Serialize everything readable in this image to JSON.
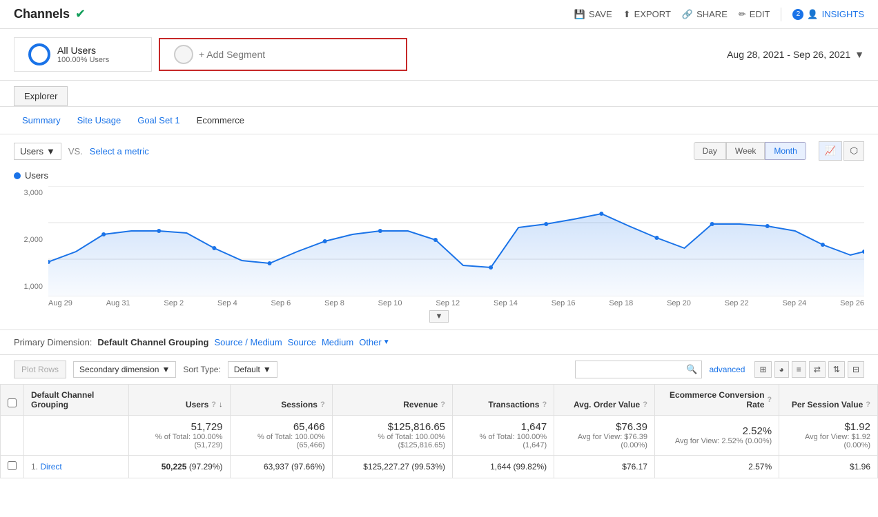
{
  "header": {
    "title": "Channels",
    "save_label": "SAVE",
    "export_label": "EXPORT",
    "share_label": "SHARE",
    "edit_label": "EDIT",
    "insights_label": "INSIGHTS",
    "insights_badge": "2"
  },
  "segment": {
    "name": "All Users",
    "pct": "100.00% Users",
    "add_label": "+ Add Segment"
  },
  "date_range": {
    "value": "Aug 28, 2021 - Sep 26, 2021"
  },
  "explorer_tab": "Explorer",
  "sub_tabs": [
    {
      "label": "Summary",
      "active": true
    },
    {
      "label": "Site Usage",
      "active": false
    },
    {
      "label": "Goal Set 1",
      "active": false
    },
    {
      "label": "Ecommerce",
      "active": false,
      "plain": true
    }
  ],
  "chart_controls": {
    "metric": "Users",
    "vs_label": "VS.",
    "select_metric": "Select a metric",
    "time_buttons": [
      "Day",
      "Week",
      "Month"
    ],
    "active_time": "Month"
  },
  "chart": {
    "legend_label": "Users",
    "y_labels": [
      "3,000",
      "2,000",
      "1,000"
    ],
    "x_labels": [
      "Aug 29",
      "Aug 31",
      "Sep 2",
      "Sep 4",
      "Sep 6",
      "Sep 8",
      "Sep 10",
      "Sep 12",
      "Sep 14",
      "Sep 16",
      "Sep 18",
      "Sep 20",
      "Sep 22",
      "Sep 24",
      "Sep 26"
    ]
  },
  "dimension_bar": {
    "label": "Primary Dimension:",
    "active": "Default Channel Grouping",
    "links": [
      "Source / Medium",
      "Source",
      "Medium",
      "Other"
    ]
  },
  "table_controls": {
    "plot_rows": "Plot Rows",
    "secondary_dim": "Secondary dimension",
    "sort_type_label": "Sort Type:",
    "sort_type": "Default",
    "advanced_label": "advanced"
  },
  "table": {
    "columns": [
      {
        "label": "Default Channel Grouping",
        "align": "left"
      },
      {
        "label": "Users",
        "info": true,
        "sort": true
      },
      {
        "label": "Sessions",
        "info": true
      },
      {
        "label": "Revenue",
        "info": true
      },
      {
        "label": "Transactions",
        "info": true
      },
      {
        "label": "Avg. Order Value",
        "info": true
      },
      {
        "label": "Ecommerce Conversion Rate",
        "info": true
      },
      {
        "label": "Per Session Value",
        "info": true
      }
    ],
    "totals": {
      "users": "51,729",
      "users_sub": "% of Total: 100.00% (51,729)",
      "sessions": "65,466",
      "sessions_sub": "% of Total: 100.00% (65,466)",
      "revenue": "$125,816.65",
      "revenue_sub": "% of Total: 100.00% ($125,816.65)",
      "transactions": "1,647",
      "transactions_sub": "% of Total: 100.00% (1,647)",
      "avg_order": "$76.39",
      "avg_order_sub": "Avg for View: $76.39 (0.00%)",
      "conv_rate": "2.52%",
      "conv_rate_sub": "Avg for View: 2.52% (0.00%)",
      "per_session": "$1.92",
      "per_session_sub": "Avg for View: $1.92 (0.00%)"
    },
    "rows": [
      {
        "num": "1.",
        "channel": "Direct",
        "users": "50,225",
        "users_pct": "(97.29%)",
        "sessions": "63,937",
        "sessions_pct": "(97.66%)",
        "revenue": "$125,227.27",
        "revenue_pct": "(99.53%)",
        "transactions": "1,644",
        "transactions_pct": "(99.82%)",
        "avg_order": "$76.17",
        "conv_rate": "2.57%",
        "per_session": "$1.96"
      }
    ]
  }
}
